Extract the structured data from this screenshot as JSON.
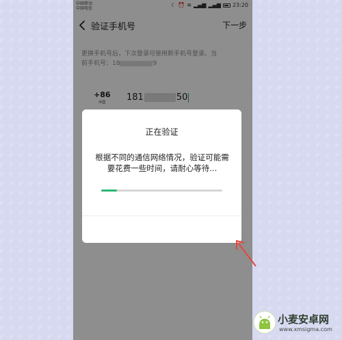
{
  "status_bar": {
    "carrier_1": "中国移动",
    "carrier_2": "中国电信",
    "time": "23:20"
  },
  "nav": {
    "back_icon": "chevron-left-icon",
    "title": "验证手机号",
    "next_label": "下一步"
  },
  "description": {
    "line_1": "更换手机号后，下次登录可使用新手机号登录。当",
    "line_2_prefix": "前手机号：18",
    "line_2_suffix": "9"
  },
  "phone_input": {
    "country_code": "+86",
    "region": "中国",
    "number_prefix": "181",
    "number_suffix": "50"
  },
  "dialog": {
    "title": "正在验证",
    "message": "根据不同的通信网络情况，验证可能需要花费一些时间，请耐心等待...",
    "progress": 0.13
  },
  "watermark": {
    "name": "小麦安卓网",
    "url": "www.xmsigma.com"
  },
  "colors": {
    "accent": "#2bb673",
    "overlay": "rgba(0,0,0,0.42)",
    "annotation": "#e8463c"
  }
}
